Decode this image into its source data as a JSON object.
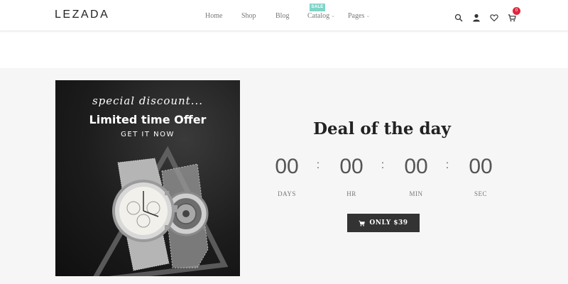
{
  "header": {
    "logo": "LEZADA",
    "nav": [
      {
        "label": "Home",
        "has_dropdown": false
      },
      {
        "label": "Shop",
        "has_dropdown": false
      },
      {
        "label": "Blog",
        "has_dropdown": false
      },
      {
        "label": "Catalog",
        "has_dropdown": true,
        "badge": "SALE"
      },
      {
        "label": "Pages",
        "has_dropdown": true
      }
    ],
    "icons": [
      "search-icon",
      "user-icon",
      "heart-icon",
      "cart-icon"
    ],
    "cart_count": "0"
  },
  "promo": {
    "script_text": "special discount...",
    "title": "Limited time Offer",
    "cta": "GET IT NOW"
  },
  "deal": {
    "title": "Deal of the day",
    "countdown": [
      {
        "value": "00",
        "label": "DAYS"
      },
      {
        "value": "00",
        "label": "HR"
      },
      {
        "value": "00",
        "label": "MIN"
      },
      {
        "value": "00",
        "label": "SEC"
      }
    ],
    "separator": ":",
    "button_label": "ONLY $39"
  },
  "colors": {
    "accent_badge": "#80d4c8",
    "cart_badge": "#e0263c",
    "button_bg": "#333333",
    "section_bg": "#f6f6f6"
  }
}
